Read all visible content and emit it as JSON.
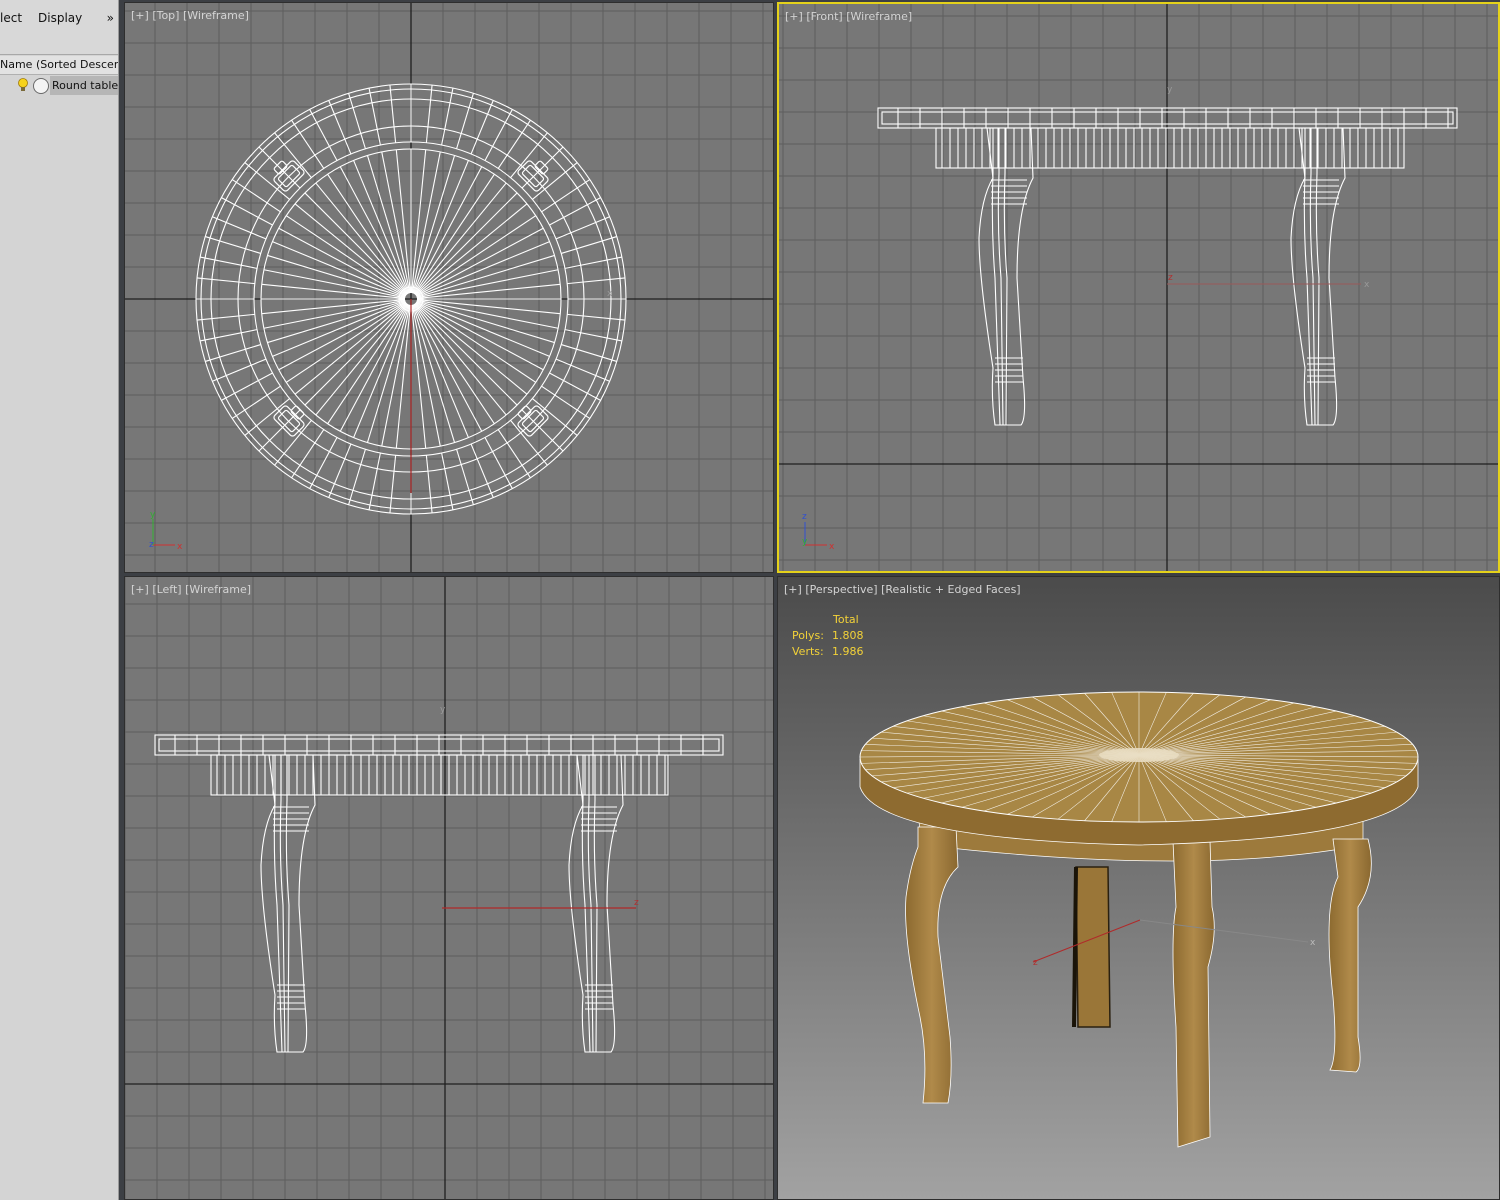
{
  "explorer": {
    "menu": {
      "select": "lect",
      "display": "Display",
      "more": "»"
    },
    "column_header": "Name (Sorted Descending)",
    "objects": [
      {
        "name": "Round table"
      }
    ]
  },
  "viewports": {
    "top": {
      "plus": "[+]",
      "view": "[Top]",
      "mode": "[Wireframe]"
    },
    "front": {
      "plus": "[+]",
      "view": "[Front]",
      "mode": "[Wireframe]"
    },
    "left": {
      "plus": "[+]",
      "view": "[Left]",
      "mode": "[Wireframe]"
    },
    "perspective": {
      "plus": "[+]",
      "view": "[Perspective]",
      "mode": "[Realistic + Edged Faces]"
    }
  },
  "stats": {
    "title": "Total",
    "polys_label": "Polys:",
    "polys_value": "1.808",
    "verts_label": "Verts:",
    "verts_value": "1.986"
  },
  "axis_labels": {
    "x": "x",
    "y": "y",
    "z": "z"
  },
  "colors": {
    "viewport_bg": "#777777",
    "grid": "#5a5a5a",
    "active_border": "#e4d11a",
    "wire": "#ffffff",
    "wood": "#a07d3e",
    "stats_text": "#f3d238"
  }
}
